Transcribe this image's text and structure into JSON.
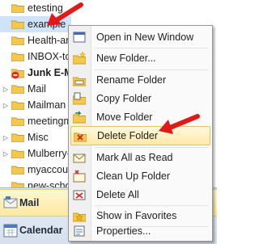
{
  "folders": [
    {
      "label": "etesting",
      "bold": false,
      "expandable": false,
      "icon": "folder-icon"
    },
    {
      "label": "example",
      "bold": false,
      "expandable": false,
      "icon": "folder-icon"
    },
    {
      "label": "Health-ar",
      "bold": false,
      "expandable": false,
      "icon": "folder-icon"
    },
    {
      "label": "INBOX-to",
      "bold": false,
      "expandable": false,
      "icon": "folder-icon"
    },
    {
      "label": "Junk E-M",
      "bold": true,
      "expandable": false,
      "icon": "junk-folder-icon"
    },
    {
      "label": "Mail",
      "bold": false,
      "expandable": true,
      "icon": "folder-icon"
    },
    {
      "label": "Mailman",
      "bold": false,
      "expandable": true,
      "icon": "folder-icon"
    },
    {
      "label": "meetingm",
      "bold": false,
      "expandable": false,
      "icon": "folder-icon"
    },
    {
      "label": "Misc",
      "bold": false,
      "expandable": true,
      "icon": "folder-icon"
    },
    {
      "label": "Mulberry-",
      "bold": false,
      "expandable": true,
      "icon": "folder-icon"
    },
    {
      "label": "myaccour",
      "bold": false,
      "expandable": false,
      "icon": "folder-icon"
    },
    {
      "label": "new-scho",
      "bold": false,
      "expandable": false,
      "icon": "folder-icon"
    },
    {
      "label": "",
      "bold": false,
      "expandable": false,
      "icon": "folder-icon"
    }
  ],
  "menu": {
    "items": [
      {
        "label": "Open in New Window",
        "icon": "open-window-icon"
      },
      {
        "label": "New Folder...",
        "icon": "new-folder-icon"
      },
      {
        "label": "Rename Folder",
        "icon": "rename-folder-icon"
      },
      {
        "label": "Copy Folder",
        "icon": "copy-folder-icon"
      },
      {
        "label": "Move Folder",
        "icon": "move-folder-icon"
      },
      {
        "label": "Delete Folder",
        "icon": "delete-folder-icon",
        "highlighted": true
      },
      {
        "label": "Mark All as Read",
        "icon": "mark-read-icon"
      },
      {
        "label": "Clean Up Folder",
        "icon": "clean-up-icon"
      },
      {
        "label": "Delete All",
        "icon": "delete-all-icon"
      },
      {
        "label": "Show in Favorites",
        "icon": "favorites-icon"
      },
      {
        "label": "Properties...",
        "icon": "properties-icon"
      }
    ]
  },
  "nav": {
    "mail_label": "Mail",
    "calendar_label": "Calendar"
  },
  "colors": {
    "arrow": "#e11919",
    "highlight": "#ffe9a8",
    "folder": "#f2c94c"
  }
}
